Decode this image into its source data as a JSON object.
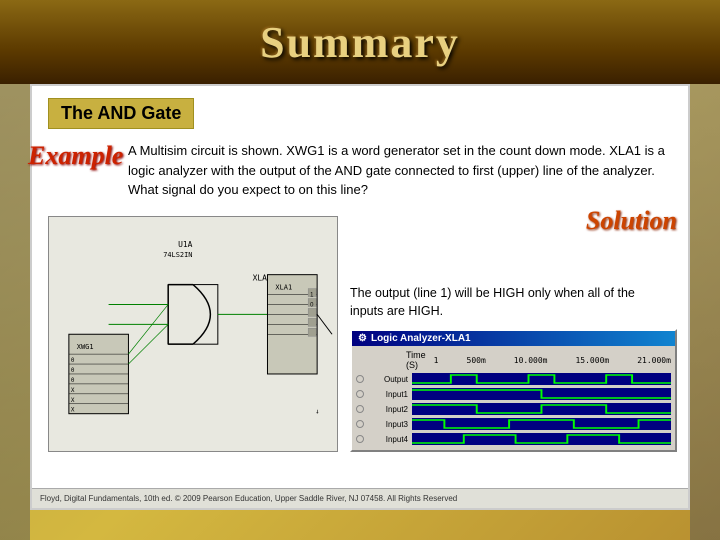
{
  "title": {
    "text": "Summary"
  },
  "slide": {
    "heading": "The AND Gate",
    "example_label": "Example",
    "example_text": "A Multisim circuit is shown. XWG1 is a word generator set in the count down mode. XLA1 is a logic analyzer with the output of the AND gate connected to first (upper) line of the analyzer. What signal do you expect to on this line?",
    "solution_label": "Solution",
    "solution_text": "The output (line 1) will be HIGH only when all of the inputs are HIGH.",
    "footer": "Floyd, Digital Fundamentals, 10th ed. © 2009 Pearson Education, Upper Saddle River, NJ 07458. All Rights Reserved"
  },
  "logic_analyzer": {
    "title": "Logic Analyzer-XLA1",
    "time_label": "Time (S)",
    "time_values": [
      "1",
      "500m",
      "10.000m",
      "15.000m",
      "21.000m"
    ],
    "channels": [
      {
        "label": "Output",
        "type": "output"
      },
      {
        "label": "Input1",
        "type": "input1"
      },
      {
        "label": "Input2",
        "type": "input2"
      },
      {
        "label": "Input3",
        "type": "input3"
      },
      {
        "label": "Input4",
        "type": "input4"
      }
    ]
  },
  "circuit": {
    "labels": {
      "u1a": "U1A",
      "ls2in": "74LS2IN",
      "xla1": "XLA1",
      "xwg1": "XWG1"
    }
  }
}
